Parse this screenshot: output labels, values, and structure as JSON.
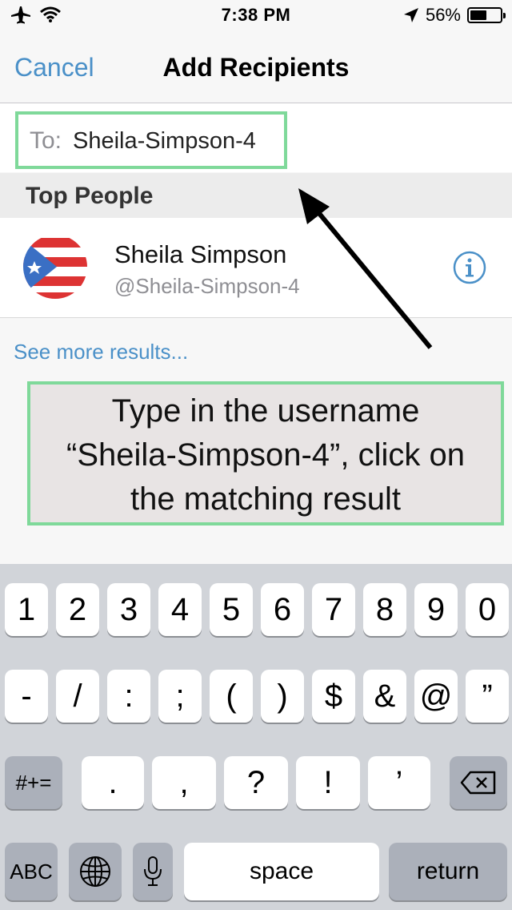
{
  "status_bar": {
    "time": "7:38 PM",
    "battery": "56%",
    "battery_level": 0.56
  },
  "nav": {
    "cancel": "Cancel",
    "title": "Add Recipients"
  },
  "to_field": {
    "label": "To:",
    "value": "Sheila-Simpson-4"
  },
  "section": {
    "title": "Top People"
  },
  "contact": {
    "name": "Sheila Simpson",
    "handle": "@Sheila-Simpson-4"
  },
  "see_more": "See more results...",
  "annotation": {
    "lines": [
      "Type in the username",
      "“Sheila-Simpson-4”, click on",
      "the matching result"
    ]
  },
  "keyboard": {
    "row1": [
      "1",
      "2",
      "3",
      "4",
      "5",
      "6",
      "7",
      "8",
      "9",
      "0"
    ],
    "row2": [
      "-",
      "/",
      ":",
      ";",
      "(",
      ")",
      "$",
      "&",
      "@",
      "”"
    ],
    "row3": [
      ".",
      ",",
      "?",
      "!",
      "’"
    ],
    "symbols_key": "#+=",
    "abc_key": "ABC",
    "space": "space",
    "return": "return"
  },
  "colors": {
    "accent": "#4a90c8",
    "highlight": "#7fd99a"
  }
}
